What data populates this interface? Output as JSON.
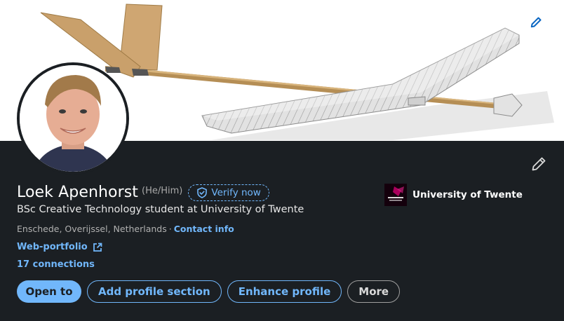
{
  "cover": {
    "image": "glider-aircraft-model",
    "edit_icon": "pencil-icon"
  },
  "profile": {
    "avatar": "profile-photo",
    "name": "Loek Apenhorst",
    "pronouns": "(He/Him)",
    "verify_label": "Verify now",
    "headline": "BSc Creative Technology student at University of Twente",
    "location": "Enschede, Overijssel, Netherlands",
    "separator": "·",
    "contact_label": "Contact info",
    "portfolio_label": "Web-portfolio",
    "connections_label": "17 connections"
  },
  "education": {
    "name": "University of Twente",
    "logo": "university-logo"
  },
  "actions": {
    "open_to": "Open to",
    "add_section": "Add profile section",
    "enhance": "Enhance profile",
    "more": "More"
  },
  "colors": {
    "background": "#1b1f23",
    "accent": "#71b7fb",
    "muted_text": "#b0b0b0"
  }
}
